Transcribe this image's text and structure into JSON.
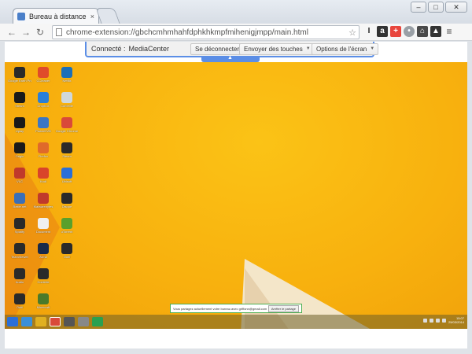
{
  "browser": {
    "tab_title": "Bureau à distance Google",
    "tab_close": "×",
    "url": "chrome-extension://gbchcmhmhahfdphkhkmpfmihenigjmpp/main.html",
    "star": "☆"
  },
  "crd_toolbar": {
    "connected_label": "Connecté :",
    "host_name": "MediaCenter",
    "disconnect_label": "Se déconnecter",
    "send_keys_label": "Envoyer des touches",
    "screen_options_label": "Options de l'écran"
  },
  "desktop": {
    "icons": [
      {
        "label": "Google Earth Pro",
        "color": "#2a2a2a"
      },
      {
        "label": "CCleaner",
        "color": "#e04a2a"
      },
      {
        "label": "Netflix",
        "color": "#1d6fb8"
      },
      {
        "label": "Steam",
        "color": "#1a1a1a"
      },
      {
        "label": "Dropbox",
        "color": "#2a7fd8"
      },
      {
        "label": "Corbeille",
        "color": "#cfd8dc"
      },
      {
        "label": "Uplay",
        "color": "#1a1a1a"
      },
      {
        "label": "PowerDVD",
        "color": "#3a76c4"
      },
      {
        "label": "Google Chrome",
        "color": "#d94a3a"
      },
      {
        "label": "Origin",
        "color": "#1a1a1a"
      },
      {
        "label": "Firefox",
        "color": "#e06a2a"
      },
      {
        "label": "Steam",
        "color": "#2a2a2a"
      },
      {
        "label": "VLC",
        "color": "#c0392b"
      },
      {
        "label": "Kodi",
        "color": "#d9442a"
      },
      {
        "label": "Ubisoft",
        "color": "#2a6fd8"
      },
      {
        "label": "Battle.net",
        "color": "#3a6fb8"
      },
      {
        "label": "Malwarebytes",
        "color": "#c0392b"
      },
      {
        "label": "Disque",
        "color": "#2a2a2a"
      },
      {
        "label": "Spotify",
        "color": "#2a2a2a"
      },
      {
        "label": "Document",
        "color": "#f0f0f0"
      },
      {
        "label": "uTorrent",
        "color": "#5aa02c"
      },
      {
        "label": "TeamViewer",
        "color": "#2a2a2a"
      },
      {
        "label": "Arma",
        "color": "#1a2a4a"
      },
      {
        "label": "Outil",
        "color": "#2a2a2a"
      },
      {
        "label": "Audio",
        "color": "#2a2a2a"
      },
      {
        "label": "Contrôle",
        "color": "#2a2a2a"
      },
      {
        "label": "",
        "color": "transparent"
      },
      {
        "label": "Outil",
        "color": "#2a2a2a"
      },
      {
        "label": "Minecraft",
        "color": "#4a7a2a"
      },
      {
        "label": "",
        "color": "transparent"
      }
    ],
    "share_message": "Vous partagez actuellement votre bureau avec griffonn@gmail.com",
    "stop_sharing_label": "Arrêter le partage",
    "clock_time": "15:07",
    "clock_date": "25/03/2014"
  },
  "colors": {
    "accent": "#5b8ee6",
    "desktop_bg": "#f8b10e",
    "share_border": "#4caf50"
  }
}
